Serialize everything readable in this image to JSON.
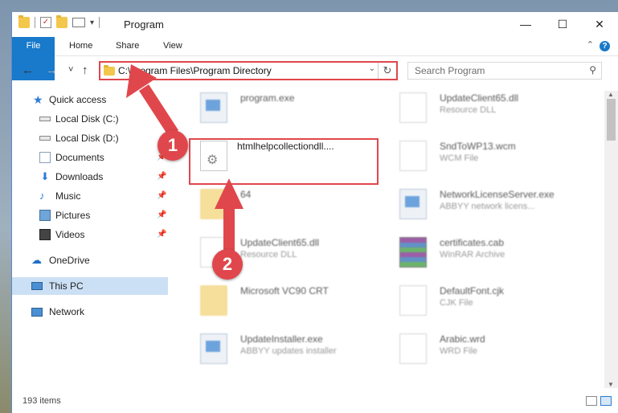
{
  "window": {
    "title": "Program",
    "controls": {
      "minimize": "—",
      "maximize": "☐",
      "close": "✕"
    }
  },
  "qat": {
    "check_glyph": "✓",
    "dropdown_glyph": "▾"
  },
  "ribbon": {
    "tabs": [
      "File",
      "Home",
      "Share",
      "View"
    ],
    "help": "?",
    "collapse": "⌃"
  },
  "nav": {
    "back": "←",
    "forward": "→",
    "recent": "˅",
    "up": "↑",
    "address": "C:\\Program Files\\Program Directory",
    "address_dropdown": "⌄",
    "refresh": "↻",
    "search_placeholder": "Search Program",
    "search_glyph": "⚲"
  },
  "sidebar": {
    "items": [
      {
        "label": "Quick access",
        "icon": "star-icon"
      },
      {
        "label": "Local Disk (C:)",
        "icon": "disk-icon"
      },
      {
        "label": "Local Disk (D:)",
        "icon": "disk-icon"
      },
      {
        "label": "Documents",
        "icon": "documents-icon",
        "pin": "📌"
      },
      {
        "label": "Downloads",
        "icon": "downloads-icon",
        "pin": "📌"
      },
      {
        "label": "Music",
        "icon": "music-icon",
        "pin": "📌"
      },
      {
        "label": "Pictures",
        "icon": "pictures-icon",
        "pin": "📌"
      },
      {
        "label": "Videos",
        "icon": "videos-icon",
        "pin": "📌"
      },
      {
        "label": "OneDrive",
        "icon": "cloud-icon"
      },
      {
        "label": "This PC",
        "icon": "computer-icon",
        "selected": true
      },
      {
        "label": "Network",
        "icon": "network-icon"
      }
    ]
  },
  "files": {
    "left": [
      {
        "name": "program.exe",
        "desc": ""
      },
      {
        "name": "htmlhelpcollectiondll....",
        "desc": ""
      },
      {
        "name": "64",
        "desc": ""
      },
      {
        "name": "UpdateClient65.dll",
        "desc": "Resource DLL"
      },
      {
        "name": "Microsoft VC90 CRT",
        "desc": ""
      },
      {
        "name": "UpdateInstaller.exe",
        "desc": "ABBYY updates installer"
      }
    ],
    "right": [
      {
        "name": "UpdateClient65.dll",
        "desc": "Resource DLL"
      },
      {
        "name": "SndToWP13.wcm",
        "desc": "WCM File"
      },
      {
        "name": "NetworkLicenseServer.exe",
        "desc": "ABBYY network licens..."
      },
      {
        "name": "certificates.cab",
        "desc": "WinRAR Archive"
      },
      {
        "name": "DefaultFont.cjk",
        "desc": "CJK File"
      },
      {
        "name": "Arabic.wrd",
        "desc": "WRD File"
      }
    ]
  },
  "status": {
    "item_count": "193 items"
  },
  "annotations": {
    "step1": "1",
    "step2": "2",
    "accent": "#e0474c"
  },
  "scroll": {
    "up": "▲",
    "down": "▼"
  }
}
